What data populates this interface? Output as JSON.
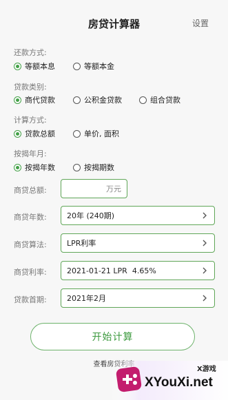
{
  "header": {
    "title": "房贷计算器",
    "settings": "设置"
  },
  "repayment": {
    "label": "还款方式:",
    "options": [
      {
        "label": "等额本息",
        "selected": true
      },
      {
        "label": "等额本金",
        "selected": false
      }
    ]
  },
  "loan_type": {
    "label": "贷款类别:",
    "options": [
      {
        "label": "商代贷款",
        "selected": true
      },
      {
        "label": "公积金贷款",
        "selected": false
      },
      {
        "label": "组合贷款",
        "selected": false
      }
    ]
  },
  "calc_method": {
    "label": "计算方式:",
    "options": [
      {
        "label": "贷款总额",
        "selected": true
      },
      {
        "label": "单价, 面积",
        "selected": false
      }
    ]
  },
  "by_term": {
    "label": "按揭年月:",
    "options": [
      {
        "label": "按揭年数",
        "selected": true
      },
      {
        "label": "按揭期数",
        "selected": false
      }
    ]
  },
  "fields": {
    "total": {
      "label": "商贷总额:",
      "value": "",
      "unit": "万元"
    },
    "years": {
      "label": "商贷年数:",
      "value": "20年 (240期)"
    },
    "algorithm": {
      "label": "商贷算法:",
      "value": "LPR利率"
    },
    "rate": {
      "label": "商贷利率:",
      "value": "2021-01-21 LPR  4.65%"
    },
    "first_month": {
      "label": "贷款首期:",
      "value": "2021年2月"
    }
  },
  "actions": {
    "start": "开始计算",
    "view_rates": "查看房贷利率"
  },
  "watermark": {
    "brand": "XYouXi.net",
    "tag": "X游戏"
  },
  "colors": {
    "accent": "#43a047",
    "border": "#5fa657"
  }
}
